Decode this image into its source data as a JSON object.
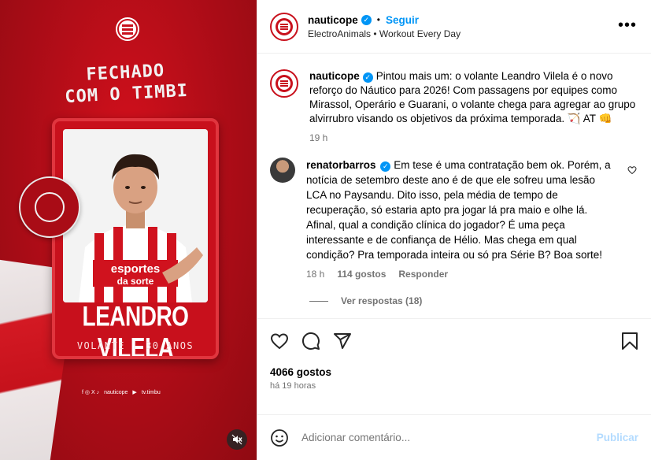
{
  "media": {
    "headline_line1": "FECHADO",
    "headline_line2": "COM O TIMBI",
    "player_name": "LEANDRO VILELA",
    "player_role": "VOLANTE | 30 ANOS",
    "sponsor": "esportes da sorte",
    "seal_text": "FECHADO COM O TIMBI",
    "social_handle": "nauticope",
    "social_tv": "tv.timbu",
    "brand_red": "#c8101c"
  },
  "header": {
    "username": "nauticope",
    "follow_label": "Seguir",
    "audio_artist": "ElectroAnimals",
    "audio_track": "Workout Every Day",
    "more_label": "•••"
  },
  "post": {
    "username": "nauticope",
    "caption": "Pintou mais um: o volante Leandro Vilela é o novo reforço do Náutico para 2026! Com passagens por equipes como Mirassol, Operário e Guarani, o volante chega para agregar ao grupo alvirrubro visando os objetivos da próxima temporada. 🏹 AT 👊",
    "time": "19 h"
  },
  "comment": {
    "username": "renatorbarros",
    "text": "Em tese é uma contratação bem ok. Porém, a notícia de setembro deste ano é de que ele sofreu uma lesão LCA no Paysandu. Dito isso, pela média de tempo de recuperação, só estaria apto pra jogar lá pra maio e olhe lá. Afinal, qual a condição clínica do jogador? É uma peça interessante e de confiança de Hélio. Mas chega em qual condição? Pra temporada inteira ou só pra Série B? Boa sorte!",
    "time": "18 h",
    "likes": "114 gostos",
    "reply_label": "Responder",
    "view_replies": "Ver respostas (18)"
  },
  "actions": {
    "likes_count": "4066 gostos",
    "posted_ago": "há 19 horas"
  },
  "composer": {
    "placeholder": "Adicionar comentário...",
    "publish_label": "Publicar"
  },
  "icons": [
    "heart-icon",
    "comment-icon",
    "share-icon",
    "bookmark-icon",
    "emoji-icon",
    "mute-icon",
    "verified-icon"
  ]
}
